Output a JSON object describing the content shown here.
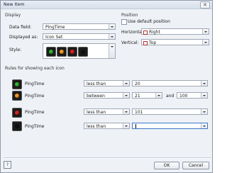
{
  "window": {
    "title": "New Item",
    "close_glyph": "✕"
  },
  "display": {
    "group_label": "Display",
    "data_field_label": "Data field:",
    "data_field_value": "PingTime",
    "displayed_as_label": "Displayed as:",
    "displayed_as_value": "Icon Set",
    "style_label": "Style:",
    "style_colors": [
      "#2fb82f",
      "#ff9a1a",
      "#e02020",
      "#111111"
    ]
  },
  "position": {
    "group_label": "Position",
    "use_default_label": "Use default position",
    "horizontal_label": "Horizontal:",
    "horizontal_value": "Right",
    "vertical_label": "Vertical:",
    "vertical_value": "Top"
  },
  "rules": {
    "group_label": "Rules for showing each icon",
    "items": [
      {
        "color": "#2fb82f",
        "field": "PingTime",
        "operator": "less than",
        "value1": "20"
      },
      {
        "color": "#ff9a1a",
        "field": "PingTime",
        "operator": "between",
        "value1": "21",
        "and_label": "and",
        "value2": "100"
      },
      {
        "color": "#e02020",
        "field": "PingTime",
        "operator": "less than",
        "value1": "101"
      },
      {
        "color": "#111111",
        "field": "PingTime",
        "operator": "less than",
        "value1": ""
      }
    ]
  },
  "footer": {
    "ok_label": "OK",
    "cancel_label": "Cancel",
    "help_icon": "help-icon"
  }
}
